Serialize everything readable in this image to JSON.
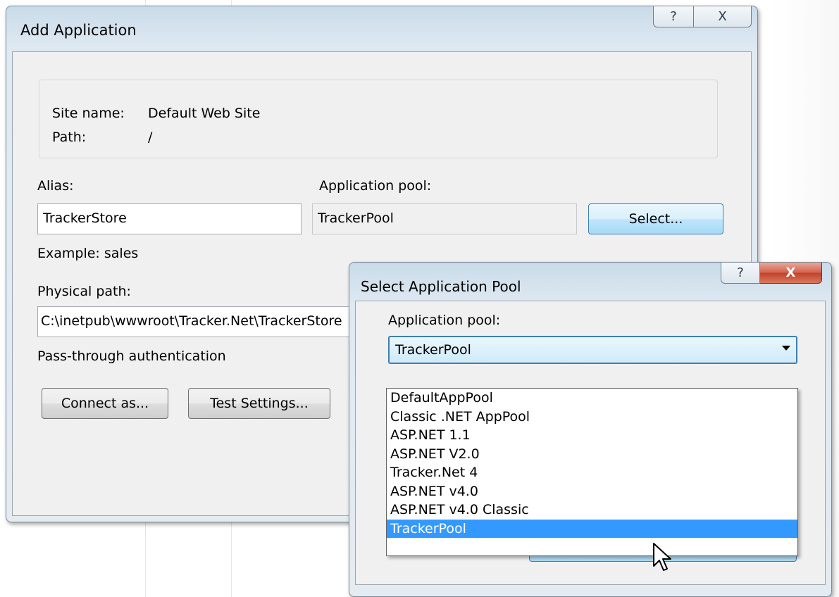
{
  "add_dialog": {
    "title": "Add Application",
    "help_glyph": "?",
    "close_glyph": "X",
    "site_name_label": "Site name:",
    "site_name_value": "Default Web Site",
    "path_label": "Path:",
    "path_value": "/",
    "alias_label": "Alias:",
    "alias_value": "TrackerStore",
    "alias_example": "Example: sales",
    "app_pool_label": "Application pool:",
    "app_pool_value": "TrackerPool",
    "select_button": "Select...",
    "physical_path_label": "Physical path:",
    "physical_path_value": "C:\\inetpub\\wwwroot\\Tracker.Net\\TrackerStore",
    "passthrough_label": "Pass-through authentication",
    "connect_as_button": "Connect as...",
    "test_settings_button": "Test Settings..."
  },
  "pool_dialog": {
    "title": "Select Application Pool",
    "help_glyph": "?",
    "close_glyph": "X",
    "app_pool_label": "Application pool:",
    "selected": "TrackerPool",
    "options": [
      "DefaultAppPool",
      "Classic .NET AppPool",
      "ASP.NET 1.1",
      "ASP.NET V2.0",
      "Tracker.Net 4",
      "ASP.NET v4.0",
      "ASP.NET v4.0 Classic",
      "TrackerPool"
    ],
    "highlighted_index": 7
  },
  "icons": {
    "help": "question-mark-icon",
    "close": "close-x-icon",
    "dropdown": "chevron-down-icon",
    "cursor": "mouse-pointer-icon"
  },
  "colors": {
    "selection": "#3399ff",
    "focus_border": "#3c7fb1",
    "close_red": "#c2412a"
  }
}
